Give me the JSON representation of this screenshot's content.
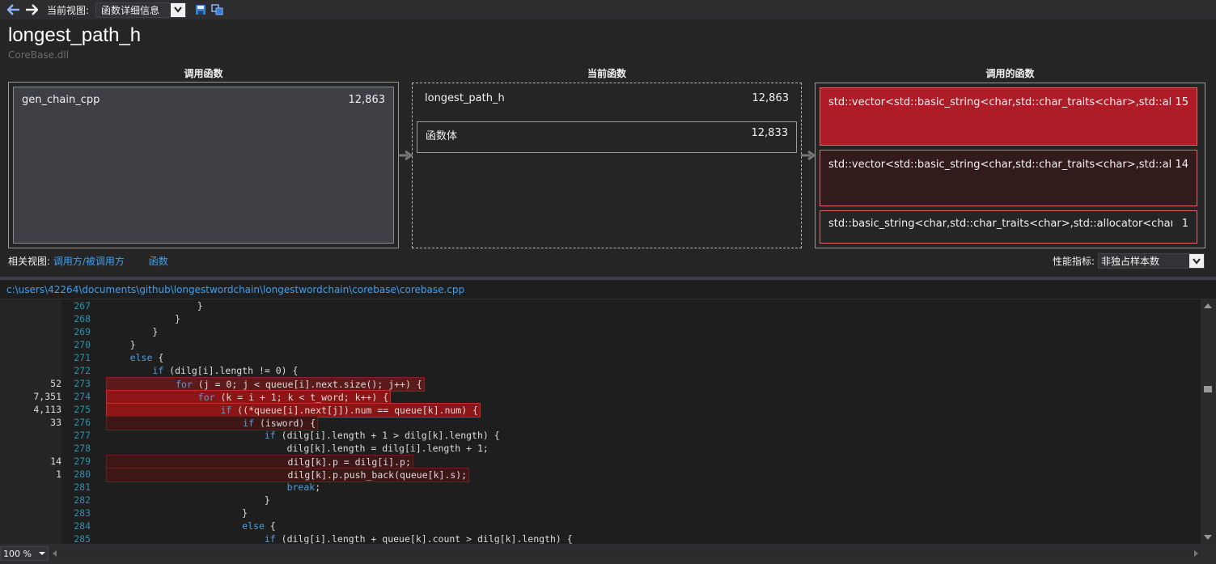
{
  "toolbar": {
    "back_icon": "back-arrow-icon",
    "forward_icon": "forward-arrow-icon",
    "view_label": "当前视图:",
    "view_value": "函数详细信息",
    "save_icon": "save-icon",
    "copy_icon": "copy-icon"
  },
  "function": {
    "name": "longest_path_h",
    "module": "CoreBase.dll"
  },
  "columns": {
    "callers_title": "调用函数",
    "current_title": "当前函数",
    "callees_title": "调用的函数"
  },
  "callers": [
    {
      "name": "gen_chain_cpp",
      "value": "12,863"
    }
  ],
  "current": {
    "name": "longest_path_h",
    "value": "12,863",
    "body_label": "函数体",
    "body_value": "12,833"
  },
  "callees": [
    {
      "name": "std::vector<std::basic_string<char,std::char_traits<char>,std::allocator<char> > >",
      "value": "15",
      "color": "#ae1c28"
    },
    {
      "name": "std::vector<std::basic_string<char,std::char_traits<char>,std::allocator<char> > >",
      "value": "14",
      "color": "#331b1c"
    },
    {
      "name": "std::basic_string<char,std::char_traits<char>,std::allocator<char> >::basic_string",
      "value": "1",
      "color": "#252526"
    }
  ],
  "related": {
    "label": "相关视图:",
    "link1": "调用方/被调用方",
    "link2": "函数"
  },
  "metric": {
    "label": "性能指标:",
    "value": "非独占样本数"
  },
  "file_path": "c:\\users\\42264\\documents\\github\\longestwordchain\\longestwordchain\\corebase\\corebase.cpp",
  "code_lines": [
    {
      "ln": "267",
      "samples": "",
      "code": "                }",
      "hl": ""
    },
    {
      "ln": "268",
      "samples": "",
      "code": "            }",
      "hl": ""
    },
    {
      "ln": "269",
      "samples": "",
      "code": "        }",
      "hl": ""
    },
    {
      "ln": "270",
      "samples": "",
      "code": "    }",
      "hl": ""
    },
    {
      "ln": "271",
      "samples": "",
      "code": "    else {",
      "hl": ""
    },
    {
      "ln": "272",
      "samples": "",
      "code": "        if (dilg[i].length != 0) {",
      "hl": ""
    },
    {
      "ln": "273",
      "samples": "52",
      "code": "            for (j = 0; j < queue[i].next.size(); j++) {",
      "hl": "mid"
    },
    {
      "ln": "274",
      "samples": "7,351",
      "code": "                for (k = i + 1; k < t_word; k++) {",
      "hl": "high"
    },
    {
      "ln": "275",
      "samples": "4,113",
      "code": "                    if ((*queue[i].next[j]).num == queue[k].num) {",
      "hl": "high"
    },
    {
      "ln": "276",
      "samples": "33",
      "code": "                        if (isword) {",
      "hl": "low"
    },
    {
      "ln": "277",
      "samples": "",
      "code": "                            if (dilg[i].length + 1 > dilg[k].length) {",
      "hl": ""
    },
    {
      "ln": "278",
      "samples": "",
      "code": "                                dilg[k].length = dilg[i].length + 1;",
      "hl": ""
    },
    {
      "ln": "279",
      "samples": "14",
      "code": "                                dilg[k].p = dilg[i].p;",
      "hl": "low"
    },
    {
      "ln": "280",
      "samples": "1",
      "code": "                                dilg[k].p.push_back(queue[k].s);",
      "hl": "low"
    },
    {
      "ln": "281",
      "samples": "",
      "code": "                                break;",
      "hl": ""
    },
    {
      "ln": "282",
      "samples": "",
      "code": "                            }",
      "hl": ""
    },
    {
      "ln": "283",
      "samples": "",
      "code": "                        }",
      "hl": ""
    },
    {
      "ln": "284",
      "samples": "",
      "code": "                        else {",
      "hl": ""
    },
    {
      "ln": "285",
      "samples": "",
      "code": "                            if (dilg[i].length + queue[k].count > dilg[k].length) {",
      "hl": ""
    }
  ],
  "status": {
    "zoom": "100 %"
  }
}
